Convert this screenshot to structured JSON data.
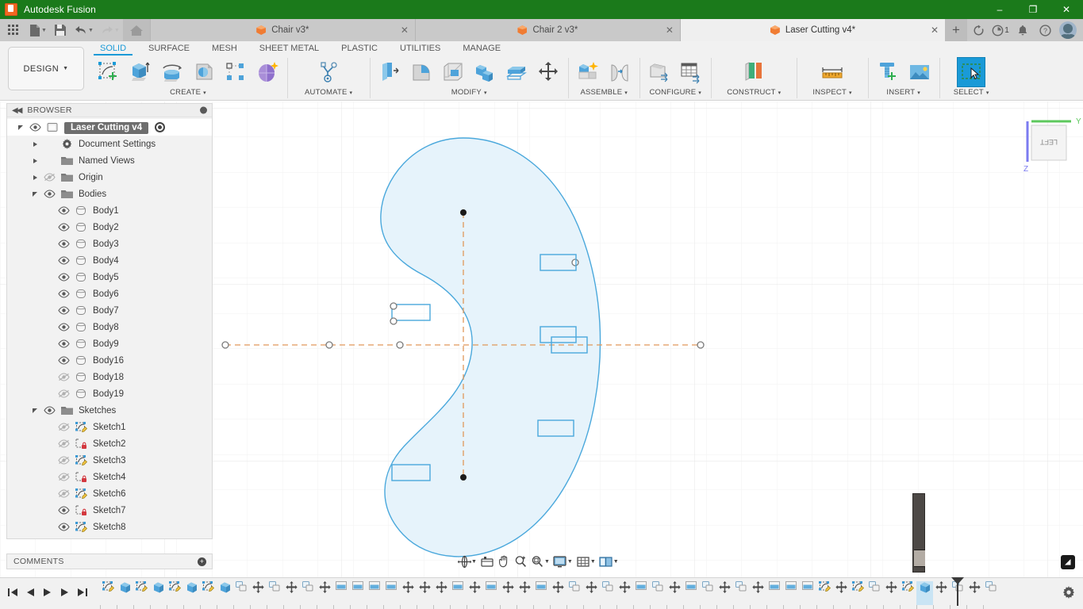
{
  "window": {
    "app_title": "Autodesk Fusion",
    "app_icon": "fusion-app-icon",
    "minimize": "–",
    "maximize": "❐",
    "close": "✕"
  },
  "quick_access": {
    "grid_icon": "app-grid-icon",
    "new_icon": "new-document-icon",
    "save_icon": "save-icon",
    "undo_icon": "undo-icon",
    "redo_icon": "redo-icon",
    "home_icon": "home-icon",
    "new_tab_label": "+",
    "refresh_icon": "refresh-icon",
    "jobs_icon": "job-status-icon",
    "jobs_count": "1",
    "notifications_icon": "bell-icon",
    "help_icon": "help-icon",
    "avatar": "user-avatar"
  },
  "document_tabs": [
    {
      "label": "Chair v3*",
      "active": false,
      "close": "✕"
    },
    {
      "label": "Chair 2 v3*",
      "active": false,
      "close": "✕"
    },
    {
      "label": "Laser Cutting v4*",
      "active": true,
      "close": "✕"
    }
  ],
  "workspace_selector": {
    "label": "DESIGN",
    "caret": "▼"
  },
  "ribbon_tabs": [
    {
      "label": "SOLID",
      "active": true
    },
    {
      "label": "SURFACE",
      "active": false
    },
    {
      "label": "MESH",
      "active": false
    },
    {
      "label": "SHEET METAL",
      "active": false
    },
    {
      "label": "PLASTIC",
      "active": false
    },
    {
      "label": "UTILITIES",
      "active": false
    },
    {
      "label": "MANAGE",
      "active": false
    }
  ],
  "ribbon_groups": [
    {
      "label": "CREATE",
      "caret": "▾",
      "icons": [
        "create-sketch-icon",
        "extrude-icon",
        "revolve-icon",
        "sweep-icon",
        "pattern-icon",
        "form-icon"
      ]
    },
    {
      "label": "AUTOMATE",
      "caret": "▾",
      "icons": [
        "automate-icon"
      ]
    },
    {
      "label": "MODIFY",
      "caret": "▾",
      "icons": [
        "press-pull-icon",
        "fillet-icon",
        "shell-icon",
        "combine-icon",
        "offset-face-icon",
        "move-copy-icon"
      ]
    },
    {
      "label": "ASSEMBLE",
      "caret": "▾",
      "icons": [
        "new-component-icon",
        "joint-icon"
      ]
    },
    {
      "label": "CONFIGURE",
      "caret": "▾",
      "icons": [
        "configure-icon",
        "configure-table-icon"
      ]
    },
    {
      "label": "CONSTRUCT",
      "caret": "▾",
      "icons": [
        "construct-plane-icon"
      ]
    },
    {
      "label": "INSPECT",
      "caret": "▾",
      "icons": [
        "measure-icon"
      ]
    },
    {
      "label": "INSERT",
      "caret": "▾",
      "icons": [
        "insert-mcmaster-icon",
        "insert-canvas-icon"
      ]
    },
    {
      "label": "SELECT",
      "caret": "▾",
      "icons": [
        "select-window-icon"
      ]
    }
  ],
  "browser": {
    "title": "BROWSER",
    "collapse_icon": "collapse-panel-icon",
    "settings_icon": "browser-options-icon",
    "tree": [
      {
        "label": "Laser Cutting v4",
        "indent": 0,
        "expander": "open",
        "eye": "visible",
        "icon": "component-icon",
        "selected": true,
        "radio": true
      },
      {
        "label": "Document Settings",
        "indent": 1,
        "expander": "closed",
        "eye": "none",
        "icon": "gear-icon",
        "selected": false,
        "radio": false
      },
      {
        "label": "Named Views",
        "indent": 1,
        "expander": "closed",
        "eye": "none",
        "icon": "folder-icon",
        "selected": false,
        "radio": false
      },
      {
        "label": "Origin",
        "indent": 1,
        "expander": "closed",
        "eye": "hidden",
        "icon": "folder-icon",
        "selected": false,
        "radio": false
      },
      {
        "label": "Bodies",
        "indent": 1,
        "expander": "open",
        "eye": "visible",
        "icon": "folder-icon",
        "selected": false,
        "radio": false
      },
      {
        "label": "Body1",
        "indent": 2,
        "expander": "none",
        "eye": "visible",
        "icon": "body-icon",
        "selected": false,
        "radio": false
      },
      {
        "label": "Body2",
        "indent": 2,
        "expander": "none",
        "eye": "visible",
        "icon": "body-icon",
        "selected": false,
        "radio": false
      },
      {
        "label": "Body3",
        "indent": 2,
        "expander": "none",
        "eye": "visible",
        "icon": "body-icon",
        "selected": false,
        "radio": false
      },
      {
        "label": "Body4",
        "indent": 2,
        "expander": "none",
        "eye": "visible",
        "icon": "body-icon",
        "selected": false,
        "radio": false
      },
      {
        "label": "Body5",
        "indent": 2,
        "expander": "none",
        "eye": "visible",
        "icon": "body-icon",
        "selected": false,
        "radio": false
      },
      {
        "label": "Body6",
        "indent": 2,
        "expander": "none",
        "eye": "visible",
        "icon": "body-icon",
        "selected": false,
        "radio": false
      },
      {
        "label": "Body7",
        "indent": 2,
        "expander": "none",
        "eye": "visible",
        "icon": "body-icon",
        "selected": false,
        "radio": false
      },
      {
        "label": "Body8",
        "indent": 2,
        "expander": "none",
        "eye": "visible",
        "icon": "body-icon",
        "selected": false,
        "radio": false
      },
      {
        "label": "Body9",
        "indent": 2,
        "expander": "none",
        "eye": "visible",
        "icon": "body-icon",
        "selected": false,
        "radio": false
      },
      {
        "label": "Body16",
        "indent": 2,
        "expander": "none",
        "eye": "visible",
        "icon": "body-icon",
        "selected": false,
        "radio": false
      },
      {
        "label": "Body18",
        "indent": 2,
        "expander": "none",
        "eye": "hidden",
        "icon": "body-icon",
        "selected": false,
        "radio": false
      },
      {
        "label": "Body19",
        "indent": 2,
        "expander": "none",
        "eye": "hidden",
        "icon": "body-icon",
        "selected": false,
        "radio": false
      },
      {
        "label": "Sketches",
        "indent": 1,
        "expander": "open",
        "eye": "visible",
        "icon": "folder-icon",
        "selected": false,
        "radio": false
      },
      {
        "label": "Sketch1",
        "indent": 2,
        "expander": "none",
        "eye": "hidden",
        "icon": "sketch-icon",
        "selected": false,
        "radio": false
      },
      {
        "label": "Sketch2",
        "indent": 2,
        "expander": "none",
        "eye": "hidden",
        "icon": "sketch-locked-icon",
        "selected": false,
        "radio": false
      },
      {
        "label": "Sketch3",
        "indent": 2,
        "expander": "none",
        "eye": "hidden",
        "icon": "sketch-icon",
        "selected": false,
        "radio": false
      },
      {
        "label": "Sketch4",
        "indent": 2,
        "expander": "none",
        "eye": "hidden",
        "icon": "sketch-locked-icon",
        "selected": false,
        "radio": false
      },
      {
        "label": "Sketch6",
        "indent": 2,
        "expander": "none",
        "eye": "hidden",
        "icon": "sketch-icon",
        "selected": false,
        "radio": false
      },
      {
        "label": "Sketch7",
        "indent": 2,
        "expander": "none",
        "eye": "visible",
        "icon": "sketch-locked-icon",
        "selected": false,
        "radio": false
      },
      {
        "label": "Sketch8",
        "indent": 2,
        "expander": "none",
        "eye": "visible",
        "icon": "sketch-icon",
        "selected": false,
        "radio": false
      }
    ]
  },
  "comments": {
    "title": "COMMENTS",
    "add": "+"
  },
  "viewcube": {
    "face_label": "LEFT",
    "axis_y_label": "Y",
    "axis_z_label": "Z",
    "axis_y_color": "#5cc85c",
    "axis_z_color": "#7b7bf0"
  },
  "canvas": {
    "sketch_stroke": "#4aa8dc",
    "sketch_fill": "#e2f1fb",
    "construction_color": "#e09a5a",
    "grid_minor": "#f0f0f0",
    "grid_major": "#e2e2e2",
    "background": "#ffffff"
  },
  "nav_bar": [
    {
      "icon": "orbit-icon",
      "caret": "▾"
    },
    {
      "icon": "look-at-icon",
      "caret": ""
    },
    {
      "icon": "pan-icon",
      "caret": ""
    },
    {
      "icon": "zoom-in-icon",
      "caret": ""
    },
    {
      "icon": "zoom-window-icon",
      "caret": "▾"
    },
    {
      "icon": "display-settings-icon",
      "caret": "▾"
    },
    {
      "icon": "grid-snaps-icon",
      "caret": "▾"
    },
    {
      "icon": "viewports-icon",
      "caret": "▾"
    }
  ],
  "timeline": {
    "playback": [
      "go-to-beginning-icon",
      "step-back-icon",
      "play-icon",
      "step-forward-icon",
      "go-to-end-icon"
    ],
    "settings_icon": "timeline-settings-icon",
    "playhead": "timeline-playhead",
    "features": [
      "sketch-icon",
      "extrude-icon",
      "sketch-icon",
      "extrude-icon",
      "sketch-icon",
      "extrude-icon",
      "sketch-icon",
      "extrude-icon",
      "component-icon",
      "move-icon",
      "component-icon",
      "move-icon",
      "component-icon",
      "move-icon",
      "rectangular-pattern-icon",
      "rectangular-pattern-icon",
      "rectangular-pattern-icon",
      "rectangular-pattern-icon",
      "move-icon",
      "move-icon",
      "move-icon",
      "rectangular-pattern-icon",
      "move-icon",
      "rectangular-pattern-icon",
      "move-icon",
      "move-icon",
      "rectangular-pattern-icon",
      "move-icon",
      "component-icon",
      "move-icon",
      "component-icon",
      "move-icon",
      "rectangular-pattern-icon",
      "component-icon",
      "move-icon",
      "rectangular-pattern-icon",
      "component-icon",
      "move-icon",
      "component-icon",
      "move-icon",
      "rectangular-pattern-icon",
      "rectangular-pattern-icon",
      "rectangular-pattern-icon",
      "sketch-icon",
      "move-icon",
      "sketch-icon",
      "component-icon",
      "move-icon",
      "sketch-icon",
      "extrude-icon",
      "move-icon",
      "component-icon",
      "move-icon",
      "component-icon"
    ],
    "selected_index": 49
  },
  "autodesk_mark": "autodesk-logo-icon"
}
